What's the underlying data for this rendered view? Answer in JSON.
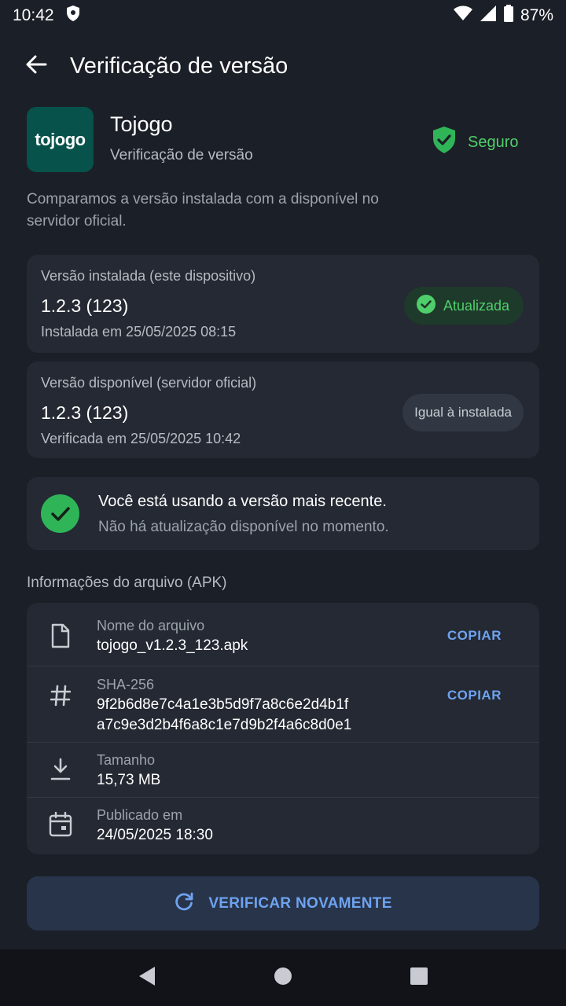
{
  "status_bar": {
    "time": "10:42",
    "battery": "87%",
    "icons": [
      "shield-icon",
      "wifi-icon",
      "signal-icon",
      "battery-icon"
    ]
  },
  "app_bar": {
    "title": "Verificação de versão"
  },
  "app": {
    "logo_text": "tojogo",
    "name": "Tojogo",
    "subtitle": "Verificação de versão",
    "security_status": "Seguro",
    "intro": "Comparamos a versão instalada com a disponível no servidor oficial."
  },
  "installed": {
    "label": "Versão instalada (este dispositivo)",
    "version": "1.2.3 (123)",
    "date": "Instalada em 25/05/2025 08:15",
    "badge": "Atualizada"
  },
  "available": {
    "label": "Versão disponível (servidor oficial)",
    "version": "1.2.3 (123)",
    "date": "Verificada em 25/05/2025 10:42",
    "badge": "Igual à instalada"
  },
  "latest": {
    "title": "Você está usando a versão mais recente.",
    "subtitle": "Não há atualização disponível no momento."
  },
  "file_info": {
    "section_title": "Informações do arquivo (APK)",
    "rows": [
      {
        "label": "Nome do arquivo",
        "value": "tojogo_v1.2.3_123.apk",
        "action": "COPIAR",
        "icon": "file-icon"
      },
      {
        "label": "SHA-256",
        "value_line1": "9f2b6d8e7c4a1e3b5d9f7a8c6e2d4b1f",
        "value_line2": "a7c9e3d2b4f6a8c1e7d9b2f4a6c8d0e1",
        "action": "COPIAR",
        "icon": "hash-icon"
      },
      {
        "label": "Tamanho",
        "value": "15,73 MB",
        "icon": "download-icon"
      },
      {
        "label": "Publicado em",
        "value": "24/05/2025 18:30",
        "icon": "calendar-icon"
      }
    ]
  },
  "actions": {
    "verify_again": "VERIFICAR NOVAMENTE"
  },
  "colors": {
    "background": "#1b1f27",
    "card": "#242933",
    "accent_blue": "#6ea3f0",
    "success_green": "#4fcf6a",
    "logo_bg": "#07524a"
  }
}
